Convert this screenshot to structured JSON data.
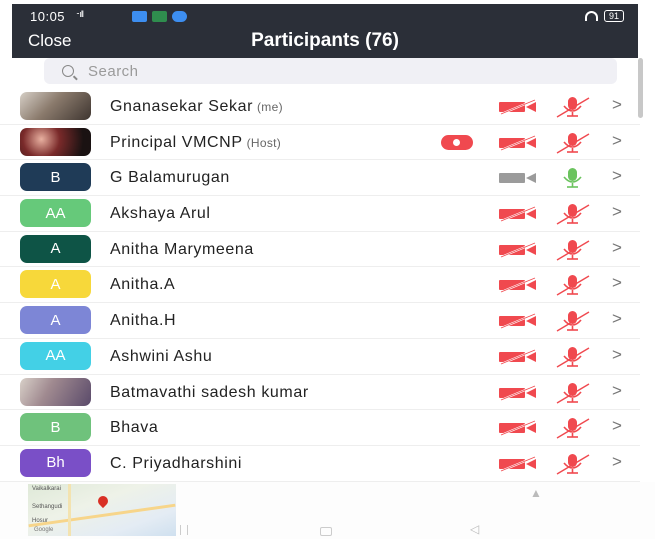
{
  "status": {
    "time": "10:05",
    "signal": "ᐧᐧ ıll",
    "battery": "91"
  },
  "header": {
    "close_label": "Close",
    "title": "Participants (76)"
  },
  "search": {
    "placeholder": "Search"
  },
  "participants": [
    {
      "avatar_text": "",
      "avatar_color": "photo1",
      "name": "Gnanasekar Sekar",
      "tag": "(me)",
      "recording": false,
      "cam": "off",
      "mic": "off"
    },
    {
      "avatar_text": "",
      "avatar_color": "photo2",
      "name": "Principal VMCNP",
      "tag": "(Host)",
      "recording": true,
      "cam": "off",
      "mic": "off"
    },
    {
      "avatar_text": "B",
      "avatar_color": "#1f3b57",
      "name": "G Balamurugan",
      "tag": "",
      "recording": false,
      "cam": "on",
      "mic": "on"
    },
    {
      "avatar_text": "AA",
      "avatar_color": "#66c97a",
      "name": "Akshaya Arul",
      "tag": "",
      "recording": false,
      "cam": "off",
      "mic": "off"
    },
    {
      "avatar_text": "A",
      "avatar_color": "#0e5446",
      "name": "Anitha Marymeena",
      "tag": "",
      "recording": false,
      "cam": "off",
      "mic": "off"
    },
    {
      "avatar_text": "A",
      "avatar_color": "#f7d83a",
      "name": "Anitha.A",
      "tag": "",
      "recording": false,
      "cam": "off",
      "mic": "off"
    },
    {
      "avatar_text": "A",
      "avatar_color": "#7d86d6",
      "name": "Anitha.H",
      "tag": "",
      "recording": false,
      "cam": "off",
      "mic": "off"
    },
    {
      "avatar_text": "AA",
      "avatar_color": "#43d0e6",
      "name": "Ashwini Ashu",
      "tag": "",
      "recording": false,
      "cam": "off",
      "mic": "off"
    },
    {
      "avatar_text": "",
      "avatar_color": "photo3",
      "name": "Batmavathi sadesh kumar",
      "tag": "",
      "recording": false,
      "cam": "off",
      "mic": "off"
    },
    {
      "avatar_text": "B",
      "avatar_color": "#6fc27c",
      "name": "Bhava",
      "tag": "",
      "recording": false,
      "cam": "off",
      "mic": "off"
    },
    {
      "avatar_text": "Bh",
      "avatar_color": "#7a4fc7",
      "name": "C. Priyadharshini",
      "tag": "",
      "recording": false,
      "cam": "off",
      "mic": "off"
    }
  ],
  "colors": {
    "header_bg": "#2b2f38",
    "muted_red": "#f0494f",
    "active_green": "#6bc35e",
    "inactive_gray": "#9b9b9b"
  },
  "icons": {
    "camera": "video-camera-icon",
    "mic": "microphone-icon",
    "chevron": "chevron-right-icon",
    "search": "search-icon"
  },
  "map": {
    "labels": [
      "Vaikalkarai",
      "Sethangudi",
      "Hosur",
      "Google"
    ]
  }
}
